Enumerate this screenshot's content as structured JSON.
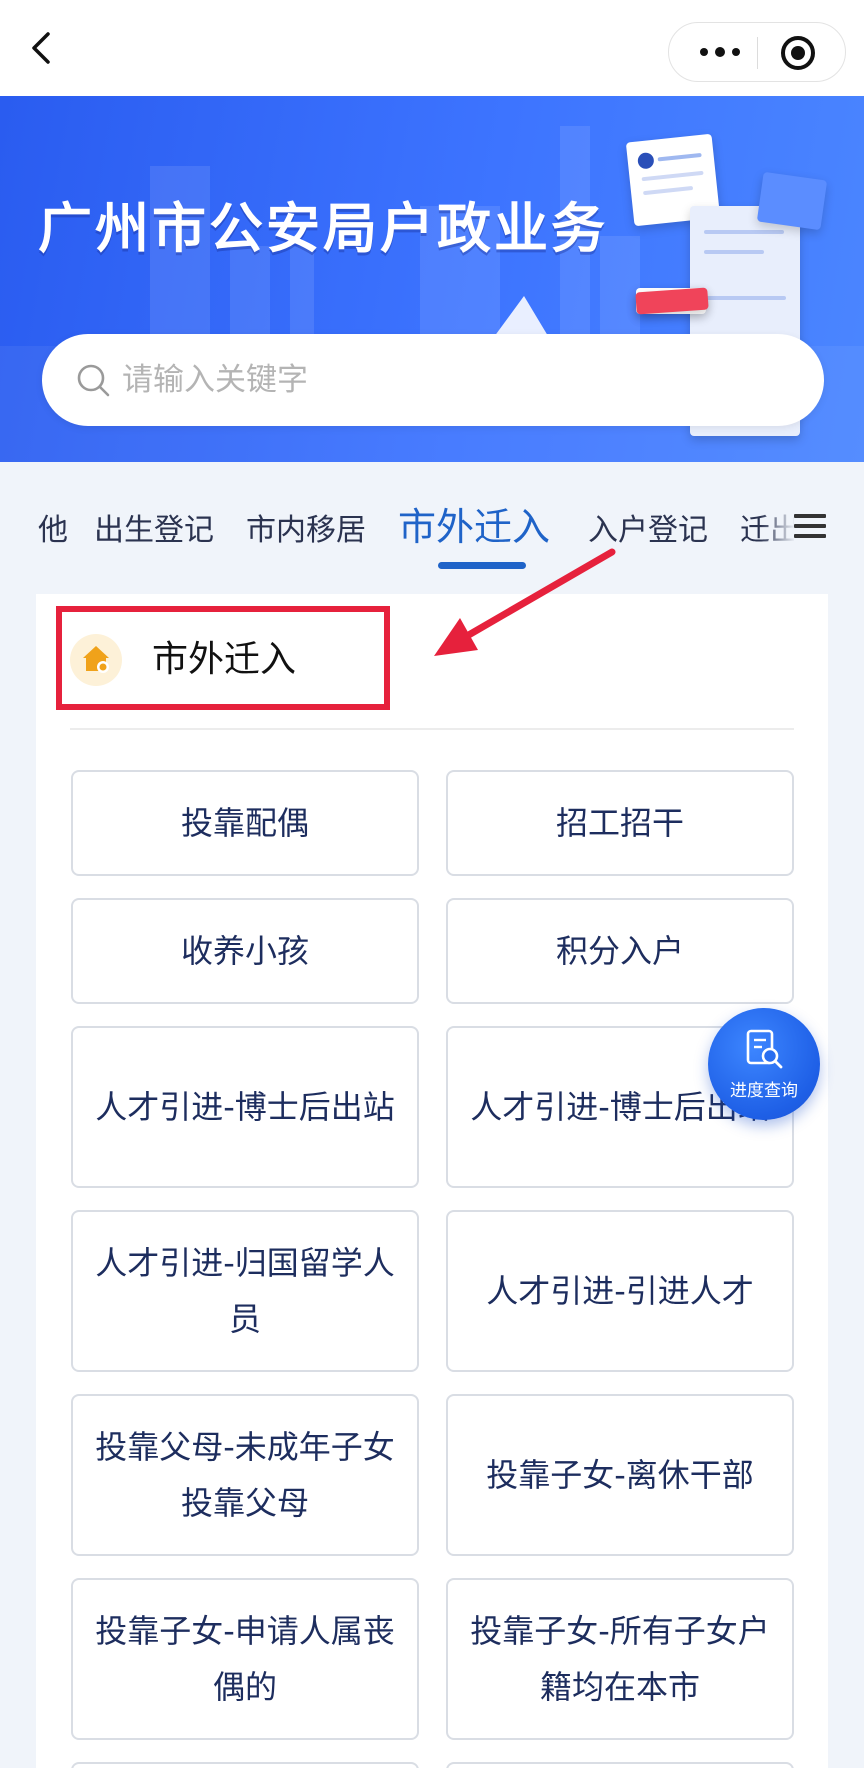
{
  "banner": {
    "title": "广州市公安局户政业务"
  },
  "search": {
    "placeholder": "请输入关键字"
  },
  "tabs": [
    {
      "label": "他"
    },
    {
      "label": "出生登记"
    },
    {
      "label": "市内移居"
    },
    {
      "label": "市外迁入"
    },
    {
      "label": "入户登记"
    },
    {
      "label": "迁出"
    }
  ],
  "section": {
    "title": "市外迁入"
  },
  "services": [
    {
      "label": "投靠配偶"
    },
    {
      "label": "招工招干"
    },
    {
      "label": "收养小孩"
    },
    {
      "label": "积分入户"
    },
    {
      "label": "人才引进-博士后出站"
    },
    {
      "label": "人才引进-博士后出站"
    },
    {
      "label": "人才引进-归国留学人员"
    },
    {
      "label": "人才引进-引进人才"
    },
    {
      "label": "投靠父母-未成年子女投靠父母"
    },
    {
      "label": "投靠子女-离休干部"
    },
    {
      "label": "投靠子女-申请人属丧偶的"
    },
    {
      "label": "投靠子女-所有子女户籍均在本市"
    }
  ],
  "fab": {
    "label": "进度查询"
  },
  "colors": {
    "accent": "#1f63c8",
    "banner": "#3d74ff",
    "highlight": "#e6213c",
    "fab": "#1e5fe6"
  }
}
